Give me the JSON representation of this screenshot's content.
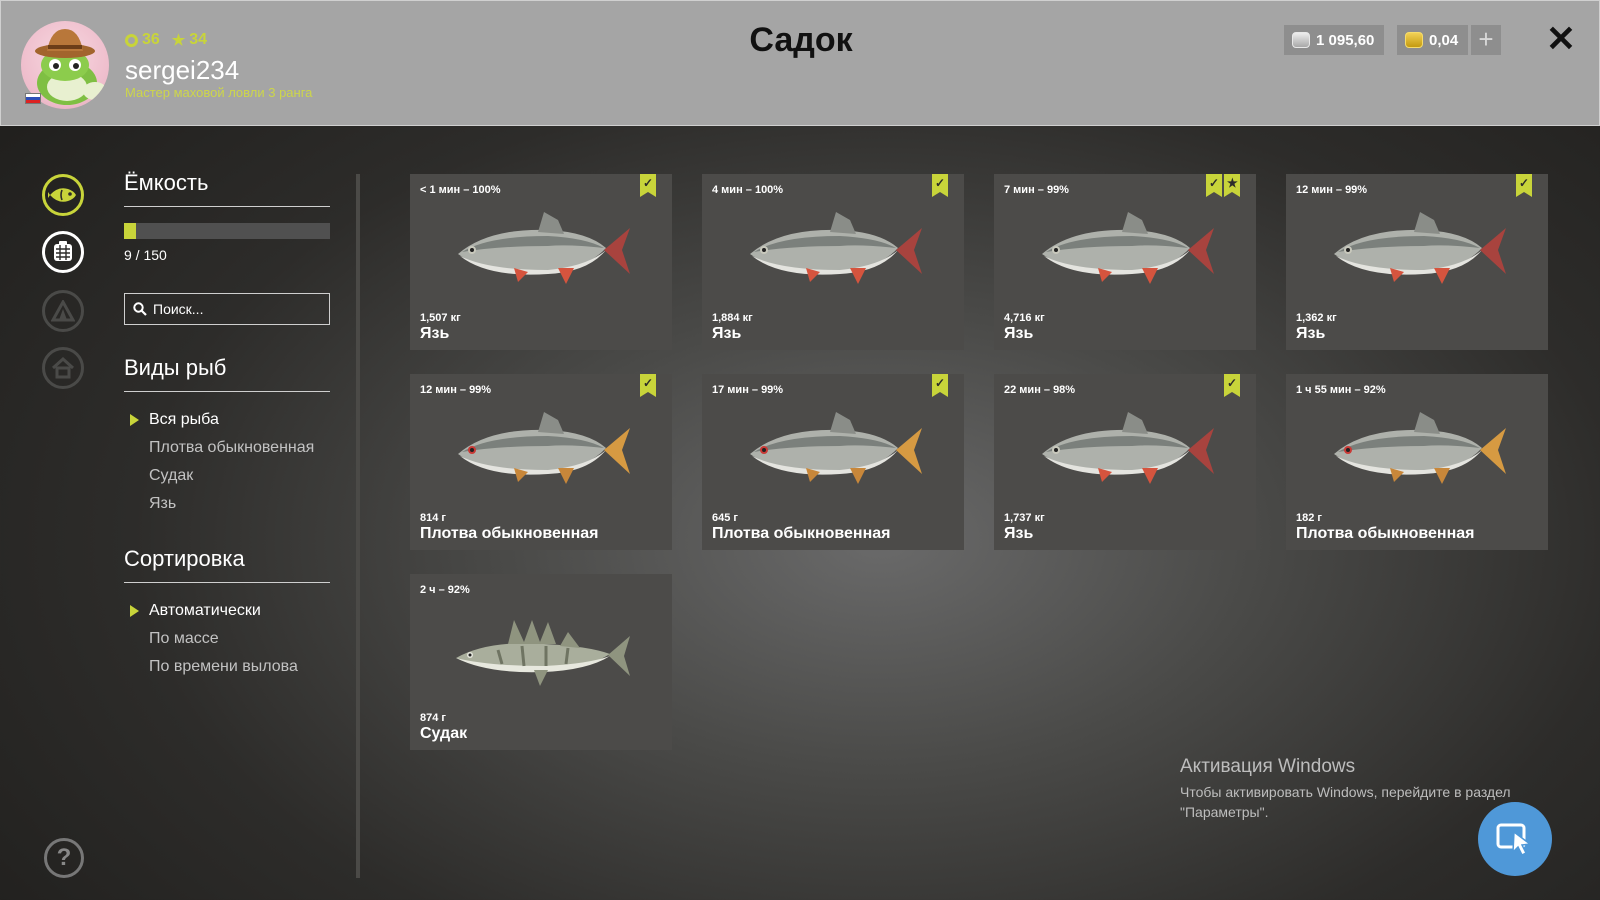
{
  "header": {
    "title": "Садок",
    "level": "36",
    "stars": "34",
    "username": "sergei234",
    "rank": "Мастер маховой ловли 3 ранга",
    "silver": "1 095,60",
    "gold": "0,04",
    "plus_label": "+",
    "close_label": "✕"
  },
  "capacity": {
    "title": "Ёмкость",
    "current": 9,
    "max": 150,
    "fill_fraction": 0.06,
    "label": "9 / 150"
  },
  "search": {
    "placeholder": "Поиск..."
  },
  "species": {
    "title": "Виды рыб",
    "items": [
      {
        "label": "Вся рыба",
        "active": true
      },
      {
        "label": "Плотва обыкновенная",
        "active": false
      },
      {
        "label": "Судак",
        "active": false
      },
      {
        "label": "Язь",
        "active": false
      }
    ]
  },
  "sorting": {
    "title": "Сортировка",
    "items": [
      {
        "label": "Автоматически",
        "active": true
      },
      {
        "label": "По массе",
        "active": false
      },
      {
        "label": "По времени вылова",
        "active": false
      }
    ]
  },
  "fish": [
    {
      "time": "< 1 мин – 100%",
      "weight": "1,507 кг",
      "name": "Язь",
      "kind": "ide",
      "bookmark": true,
      "star": false
    },
    {
      "time": "4 мин – 100%",
      "weight": "1,884 кг",
      "name": "Язь",
      "kind": "ide",
      "bookmark": true,
      "star": false
    },
    {
      "time": "7 мин – 99%",
      "weight": "4,716 кг",
      "name": "Язь",
      "kind": "ide",
      "bookmark": true,
      "star": true
    },
    {
      "time": "12 мин – 99%",
      "weight": "1,362 кг",
      "name": "Язь",
      "kind": "ide",
      "bookmark": true,
      "star": false
    },
    {
      "time": "12 мин – 99%",
      "weight": "814 г",
      "name": "Плотва обыкновенная",
      "kind": "roach",
      "bookmark": true,
      "star": false
    },
    {
      "time": "17 мин – 99%",
      "weight": "645 г",
      "name": "Плотва обыкновенная",
      "kind": "roach",
      "bookmark": true,
      "star": false
    },
    {
      "time": "22 мин – 98%",
      "weight": "1,737 кг",
      "name": "Язь",
      "kind": "ide",
      "bookmark": true,
      "star": false
    },
    {
      "time": "1 ч 55 мин – 92%",
      "weight": "182 г",
      "name": "Плотва обыкновенная",
      "kind": "roach",
      "bookmark": false,
      "star": false
    },
    {
      "time": "2 ч – 92%",
      "weight": "874 г",
      "name": "Судак",
      "kind": "zander",
      "bookmark": false,
      "star": false
    }
  ],
  "watermark": {
    "title": "Активация Windows",
    "text": "Чтобы активировать Windows, перейдите в раздел \"Параметры\"."
  },
  "colors": {
    "accent": "#c8d43a",
    "header_bg": "#a5a5a5",
    "card_bg": "#4c4b49",
    "cursor_button": "#4f98d8"
  },
  "icons": {
    "rail": [
      "fish-icon",
      "keepnet-icon",
      "tent-icon",
      "home-icon"
    ],
    "help": "help-icon"
  }
}
